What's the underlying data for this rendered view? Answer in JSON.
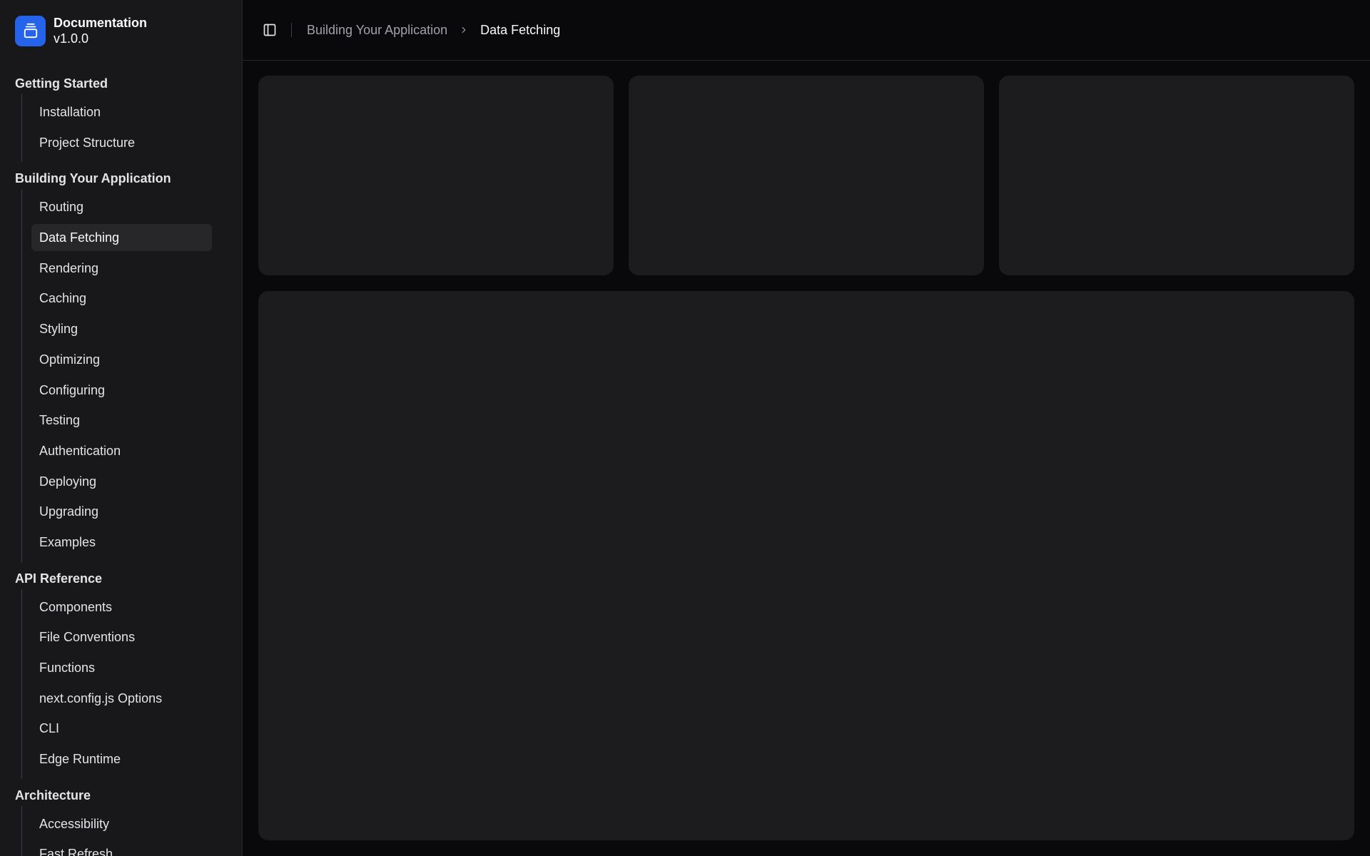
{
  "brand": {
    "title": "Documentation",
    "version": "v1.0.0",
    "logo_icon": "gallery-vertical-end-icon",
    "accent": "#2563eb"
  },
  "sidebar": {
    "groups": [
      {
        "title": "Getting Started",
        "items": [
          {
            "label": "Installation"
          },
          {
            "label": "Project Structure"
          }
        ]
      },
      {
        "title": "Building Your Application",
        "items": [
          {
            "label": "Routing"
          },
          {
            "label": "Data Fetching",
            "active": true
          },
          {
            "label": "Rendering"
          },
          {
            "label": "Caching"
          },
          {
            "label": "Styling"
          },
          {
            "label": "Optimizing"
          },
          {
            "label": "Configuring"
          },
          {
            "label": "Testing"
          },
          {
            "label": "Authentication"
          },
          {
            "label": "Deploying"
          },
          {
            "label": "Upgrading"
          },
          {
            "label": "Examples"
          }
        ]
      },
      {
        "title": "API Reference",
        "items": [
          {
            "label": "Components"
          },
          {
            "label": "File Conventions"
          },
          {
            "label": "Functions"
          },
          {
            "label": "next.config.js Options"
          },
          {
            "label": "CLI"
          },
          {
            "label": "Edge Runtime"
          }
        ]
      },
      {
        "title": "Architecture",
        "items": [
          {
            "label": "Accessibility"
          },
          {
            "label": "Fast Refresh"
          }
        ]
      }
    ]
  },
  "header": {
    "sidebar_toggle_icon": "panel-left-icon",
    "breadcrumb": {
      "parent": "Building Your Application",
      "separator_icon": "chevron-right-icon",
      "current": "Data Fetching"
    }
  },
  "colors": {
    "background": "#09090b",
    "sidebar": "#18181b",
    "card": "#1c1c1f"
  }
}
